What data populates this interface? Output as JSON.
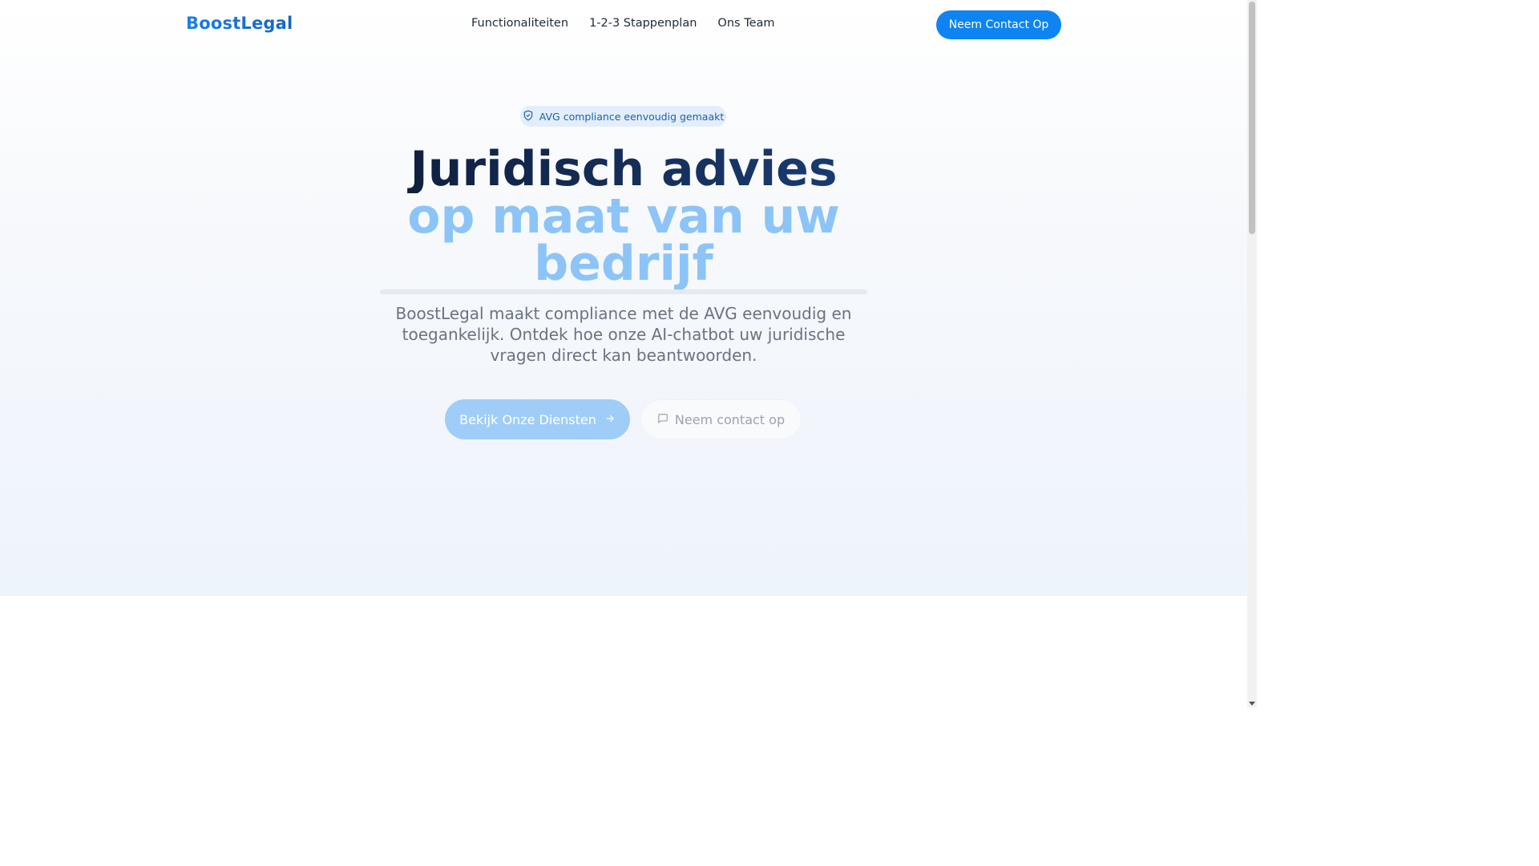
{
  "header": {
    "logo": "BoostLegal",
    "nav": [
      "Functionaliteiten",
      "1-2-3 Stappenplan",
      "Ons Team"
    ],
    "cta_label": "Neem Contact Op"
  },
  "hero": {
    "badge_icon": "shield-check-icon",
    "badge_text": "AVG compliance eenvoudig gemaakt",
    "headline_line1": "Juridisch advies",
    "headline_line2": "op maat van uw bedrijf",
    "subtitle": "BoostLegal maakt compliance met de AVG eenvoudig en toegankelijk. Ontdek hoe onze AI-chatbot uw juridische vragen direct kan beantwoorden.",
    "primary_button": "Bekijk Onze Diensten",
    "primary_button_icon": "arrow-right-icon",
    "secondary_button": "Neem contact op",
    "secondary_button_icon": "chat-bubble-icon"
  },
  "colors": {
    "accent": "#0d84f2",
    "headline_dark": "#0f1e3d",
    "headline_light": "#8cc4f7"
  }
}
